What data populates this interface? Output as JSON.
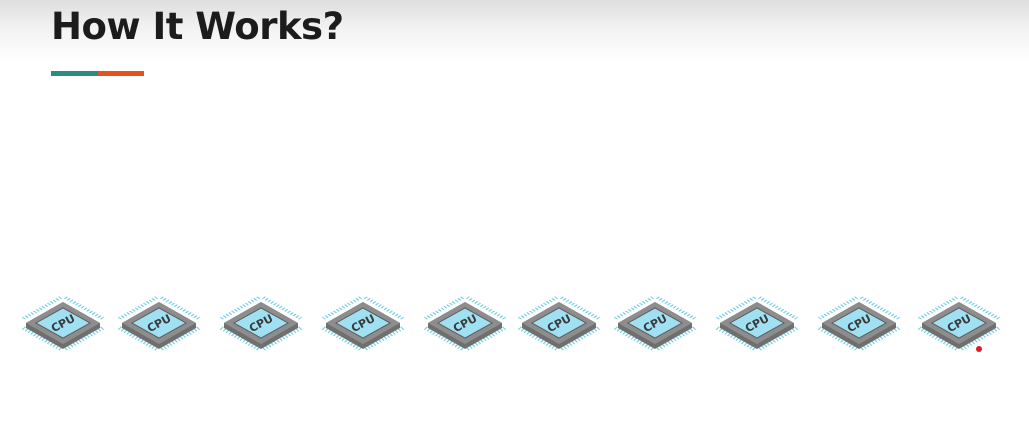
{
  "slide": {
    "title": "How It Works?"
  },
  "colors": {
    "title": "#1c1c1c",
    "accent_teal": "#2a8c80",
    "accent_orange": "#e8501c",
    "chip_core": "#9fe0f3",
    "chip_body": "#8d8d8d",
    "chip_pins": "#6ccfe6",
    "cursor": "#e01a2a"
  },
  "icons": {
    "chip": "cpu-chip-icon"
  },
  "cpus": [
    {
      "label": "CPU"
    },
    {
      "label": "CPU"
    },
    {
      "label": "CPU"
    },
    {
      "label": "CPU"
    },
    {
      "label": "CPU"
    },
    {
      "label": "CPU"
    },
    {
      "label": "CPU"
    },
    {
      "label": "CPU"
    },
    {
      "label": "CPU"
    },
    {
      "label": "CPU"
    }
  ]
}
